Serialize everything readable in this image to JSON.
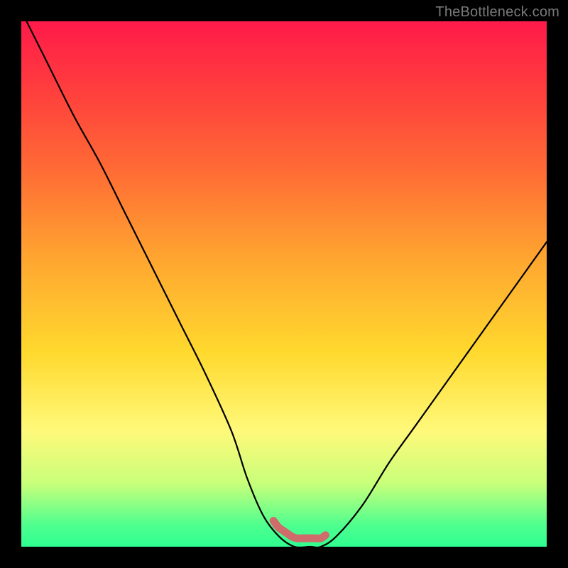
{
  "watermark": "TheBottleneck.com",
  "chart_data": {
    "type": "line",
    "title": "",
    "xlabel": "",
    "ylabel": "",
    "xlim": [
      0,
      100
    ],
    "ylim": [
      0,
      100
    ],
    "series": [
      {
        "name": "bottleneck-curve",
        "x": [
          1,
          5,
          10,
          15,
          20,
          25,
          30,
          35,
          40,
          43,
          46,
          49,
          52,
          55,
          57,
          60,
          65,
          70,
          75,
          80,
          85,
          90,
          95,
          100
        ],
        "y": [
          100,
          92,
          82,
          73,
          63,
          53,
          43,
          33,
          22,
          13,
          6,
          2,
          0,
          0,
          0,
          2,
          8,
          16,
          23,
          30,
          37,
          44,
          51,
          58
        ]
      }
    ],
    "annotations": [
      {
        "name": "optimal-range-marker",
        "x_range": [
          49,
          57
        ],
        "color": "#cf6b6b"
      }
    ],
    "gradient_stops": [
      {
        "pos": 0.0,
        "color": "#ff1a4a"
      },
      {
        "pos": 0.12,
        "color": "#ff3b3e"
      },
      {
        "pos": 0.28,
        "color": "#ff6a35"
      },
      {
        "pos": 0.45,
        "color": "#ffa530"
      },
      {
        "pos": 0.63,
        "color": "#ffd92e"
      },
      {
        "pos": 0.78,
        "color": "#fff97a"
      },
      {
        "pos": 0.88,
        "color": "#c8ff7a"
      },
      {
        "pos": 0.96,
        "color": "#4dff8f"
      },
      {
        "pos": 1.0,
        "color": "#2fff90"
      }
    ]
  }
}
